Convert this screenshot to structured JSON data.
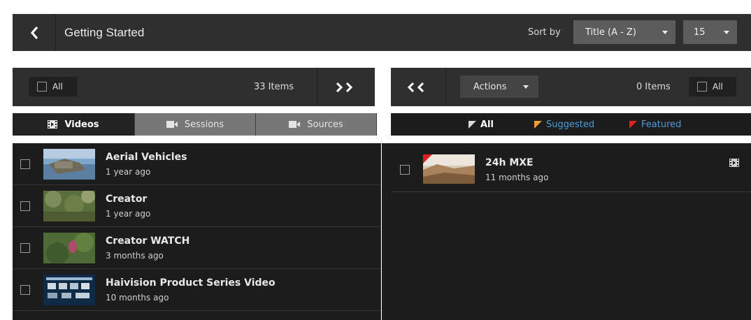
{
  "header": {
    "title": "Getting Started",
    "sort_label": "Sort by",
    "sort_value": "Title (A - Z)",
    "per_page_value": "15",
    "back_icon": "chevron-left-icon"
  },
  "left_panel": {
    "all_label": "All",
    "items_count": "33 Items",
    "tabs": [
      {
        "label": "Videos",
        "icon": "film-icon",
        "active": true
      },
      {
        "label": "Sessions",
        "icon": "camera-icon",
        "active": false
      },
      {
        "label": "Sources",
        "icon": "video-camera-icon",
        "active": false
      }
    ],
    "items": [
      {
        "title": "Aerial Vehicles",
        "age": "1 year ago"
      },
      {
        "title": "Creator",
        "age": "1 year ago"
      },
      {
        "title": "Creator WATCH",
        "age": "3 months ago"
      },
      {
        "title": "Haivision Product Series Video",
        "age": "10 months ago"
      }
    ]
  },
  "right_panel": {
    "actions_label": "Actions",
    "items_count": "0 Items",
    "all_label": "All",
    "filters": [
      {
        "label": "All",
        "color": "#d8d8d8"
      },
      {
        "label": "Suggested",
        "color": "#f0a030"
      },
      {
        "label": "Featured",
        "color": "#e02020"
      }
    ],
    "items": [
      {
        "title": "24h MXE",
        "age": "11 months ago",
        "featured": true
      }
    ]
  },
  "colors": {
    "panel": "#2f2f2f",
    "list_bg": "#1c1c1c",
    "link": "#4a9fdc",
    "suggested": "#f0a030",
    "featured": "#e02020"
  }
}
